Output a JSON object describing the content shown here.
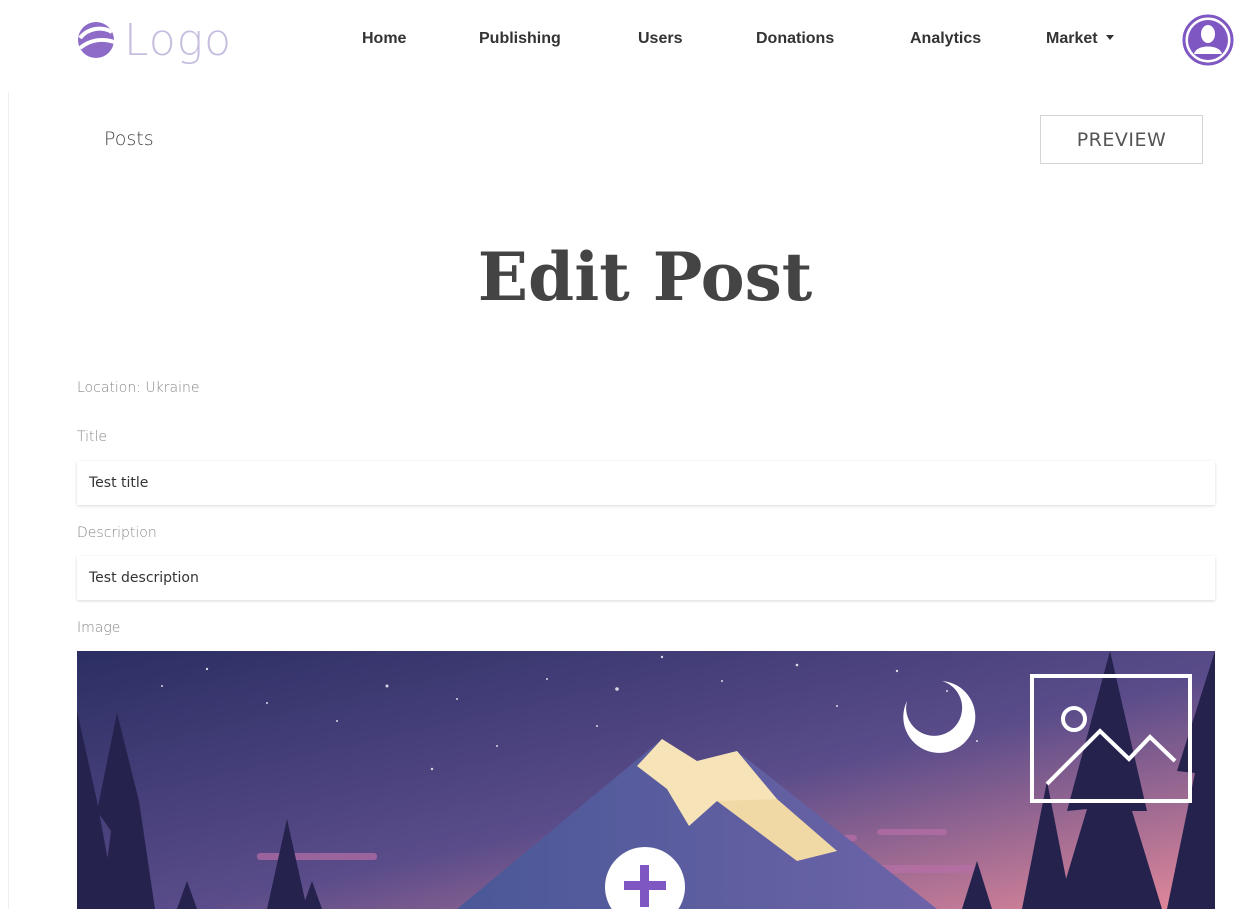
{
  "header": {
    "logo_text": "Logo",
    "nav": [
      {
        "label": "Home"
      },
      {
        "label": "Publishing"
      },
      {
        "label": "Users"
      },
      {
        "label": "Donations"
      },
      {
        "label": "Analytics"
      },
      {
        "label": "Market"
      }
    ]
  },
  "page": {
    "breadcrumb": "Posts",
    "preview_label": "PREVIEW",
    "title": "Edit Post",
    "location": "Location: Ukraine"
  },
  "form": {
    "title_label": "Title",
    "title_value": "Test title",
    "description_label": "Description",
    "description_value": "Test description",
    "image_label": "Image"
  },
  "colors": {
    "accent": "#7e57c2",
    "logo": "#c7bedf"
  },
  "icons": [
    "logo-mark-icon",
    "chevron-down-icon",
    "user-avatar-icon",
    "image-placeholder-icon",
    "plus-icon"
  ]
}
